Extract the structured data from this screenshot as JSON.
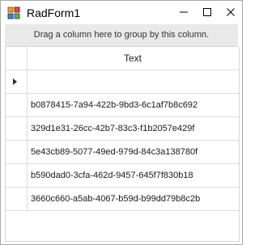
{
  "window": {
    "title": "RadForm1",
    "minimize_icon": "minimize-icon",
    "maximize_icon": "maximize-icon",
    "close_icon": "close-icon",
    "app_icon": "app-form-icon"
  },
  "grid": {
    "group_panel_text": "Drag a column here to group by this column.",
    "columns": [
      "Text"
    ],
    "new_row_indicator_icon": "current-row-arrow-icon",
    "rows": [
      "b0878415-7a94-422b-9bd3-6c1af7b8c692",
      "329d1e31-26cc-42b7-83c3-f1b2057e429f",
      "5e43cb89-5077-49ed-979d-84c3a138780f",
      "b590dad0-3cfa-462d-9457-645f7f830b18",
      "3660c660-a5ab-4067-b59d-b99dd79b8c2b"
    ]
  }
}
